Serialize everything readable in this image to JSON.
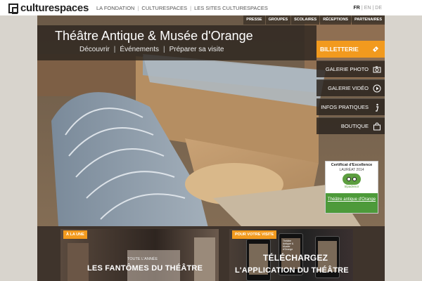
{
  "header": {
    "logo_text": "culturespaces",
    "nav": [
      "LA FONDATION",
      "CULTURESPACES",
      "LES SITES CULTURESPACES"
    ],
    "languages": [
      "FR",
      "EN",
      "DE"
    ],
    "active_language": "FR"
  },
  "secondary_nav": [
    "PRESSE",
    "GROUPES",
    "SCOLAIRES",
    "RÉCEPTIONS",
    "PARTENAIRES"
  ],
  "site": {
    "title": "Théâtre Antique & Musée d'Orange",
    "subnav": [
      "Découvrir",
      "Événements",
      "Préparer sa visite"
    ]
  },
  "side_menu": {
    "billetterie": "BILLETTERIE",
    "items": [
      {
        "label": "GALERIE PHOTO",
        "icon": "camera-icon"
      },
      {
        "label": "GALERIE VIDÉO",
        "icon": "play-icon"
      },
      {
        "label": "INFOS PRATIQUES",
        "icon": "info-icon"
      },
      {
        "label": "BOUTIQUE",
        "icon": "shop-icon"
      }
    ]
  },
  "certificate": {
    "title": "Certificat d'Excellence",
    "subtitle": "LAURÉAT 2014",
    "brand": "tripadvisor",
    "link": "Théâtre antique d'Orange"
  },
  "panels": {
    "a_la_une": {
      "tag": "À LA UNE",
      "kicker": "TOUTE L'ANNÉE",
      "headline": "LES FANTÔMES DU THÉÂTRE"
    },
    "visite": {
      "tag": "POUR VOTRE VISITE",
      "headline_1": "TÉLÉCHARGEZ",
      "headline_2": "L'APPLICATION DU THÉÂTRE",
      "phone_caption": "Théâtre Antique & Musée d'Orange"
    }
  },
  "colors": {
    "accent": "#f29a1e",
    "dark_overlay": "#2d2620",
    "tripadvisor_green": "#4d9a3a"
  }
}
